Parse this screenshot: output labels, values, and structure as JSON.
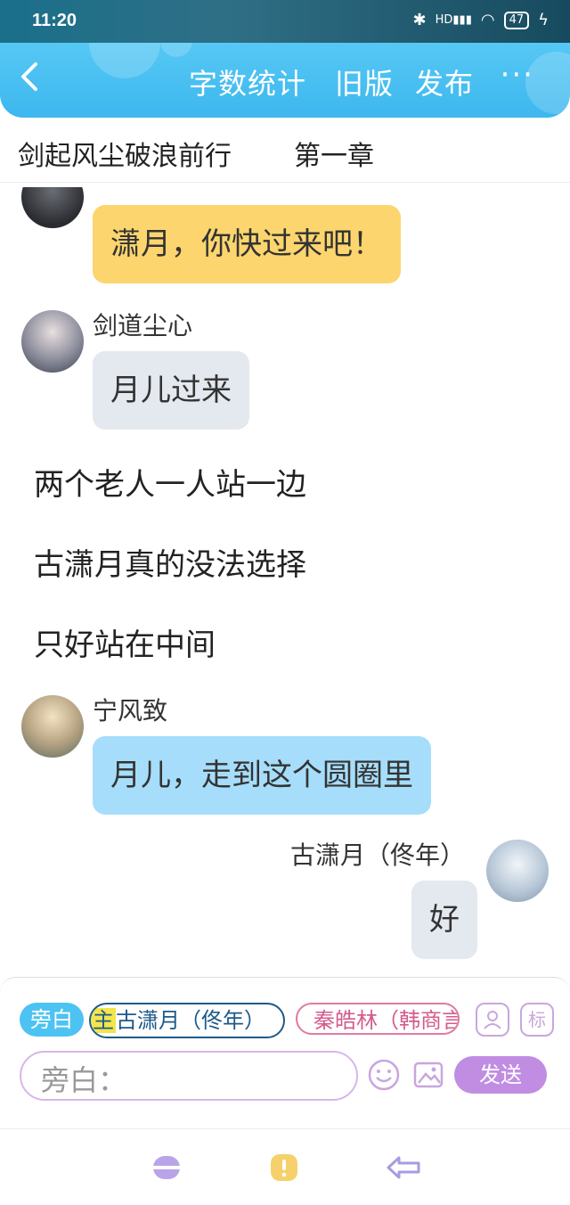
{
  "status_bar": {
    "time": "11:20",
    "signal": "HD",
    "battery": "47"
  },
  "header": {
    "word_count": "字数统计",
    "old_version": "旧版",
    "publish": "发布",
    "more": "···"
  },
  "chapter": {
    "book_title": "剑起风尘破浪前行",
    "chapter_name": "第一章"
  },
  "chat": {
    "top_message": "潇月，你快过来吧！",
    "sender1": "剑道尘心",
    "msg1": "月儿过来",
    "narration": [
      "两个老人一人站一边",
      "古潇月真的没法选择",
      "只好站在中间"
    ],
    "sender2": "宁风致",
    "msg2": "月儿，走到这个圆圈里",
    "sender3": "古潇月（佟年）",
    "msg3": "好"
  },
  "composer": {
    "narrator_chip": "旁白",
    "main_tag": "主",
    "role_main": "古潇月（佟年）",
    "role_other": "秦皓林（韩商言）",
    "mark_label": "标",
    "placeholder": "旁白：",
    "send_label": "发送"
  },
  "colors": {
    "accent": "#3db7ef",
    "send": "#c08de3",
    "yellow_bubble": "#fcd56e",
    "blue_bubble": "#a6ddfa",
    "gray_bubble": "#e4e8ef"
  }
}
